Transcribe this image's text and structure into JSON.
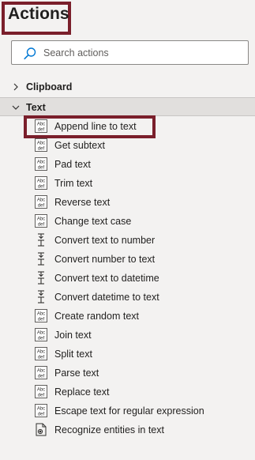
{
  "header": {
    "title": "Actions"
  },
  "search": {
    "placeholder": "Search actions",
    "value": ""
  },
  "groups": [
    {
      "label": "Clipboard",
      "expanded": false
    },
    {
      "label": "Text",
      "expanded": true
    }
  ],
  "text_actions": [
    {
      "label": "Append line to text",
      "icon": "text-abc-icon"
    },
    {
      "label": "Get subtext",
      "icon": "text-abc-icon"
    },
    {
      "label": "Pad text",
      "icon": "text-abc-icon"
    },
    {
      "label": "Trim text",
      "icon": "text-abc-icon"
    },
    {
      "label": "Reverse text",
      "icon": "text-abc-icon"
    },
    {
      "label": "Change text case",
      "icon": "text-abc-icon"
    },
    {
      "label": "Convert text to number",
      "icon": "convert-icon"
    },
    {
      "label": "Convert number to text",
      "icon": "convert-icon"
    },
    {
      "label": "Convert text to datetime",
      "icon": "convert-icon"
    },
    {
      "label": "Convert datetime to text",
      "icon": "convert-icon"
    },
    {
      "label": "Create random text",
      "icon": "text-abc-icon"
    },
    {
      "label": "Join text",
      "icon": "text-abc-icon"
    },
    {
      "label": "Split text",
      "icon": "text-abc-icon"
    },
    {
      "label": "Parse text",
      "icon": "text-abc-icon"
    },
    {
      "label": "Replace text",
      "icon": "text-abc-icon"
    },
    {
      "label": "Escape text for regular expression",
      "icon": "text-abc-icon"
    },
    {
      "label": "Recognize entities in text",
      "icon": "entity-icon"
    }
  ],
  "icon_glyphs": {
    "abc": "Abc",
    "def": "def"
  },
  "colors": {
    "highlight": "#7a1f2b",
    "accent": "#0078d4",
    "background": "#f3f2f1"
  }
}
